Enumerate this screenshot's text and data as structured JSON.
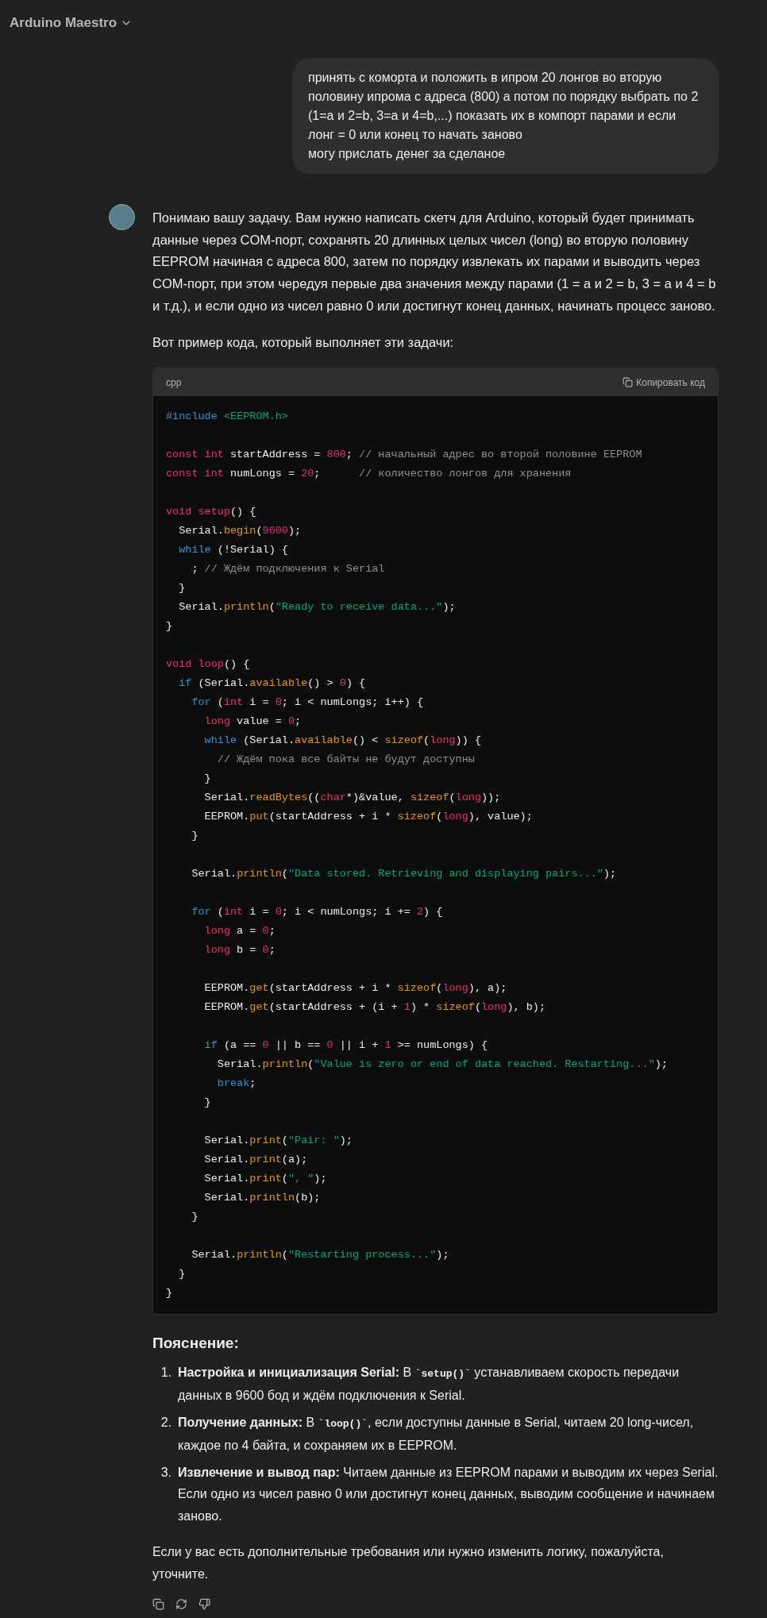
{
  "header": {
    "title": "Arduino Maestro"
  },
  "user_message": {
    "text": "принять с коморта и положить в ипром 20 лонгов во вторую половину ипрома с адреса (800) а потом по порядку выбрать по 2 (1=а и 2=b, 3=a и 4=b,...) показать их в компорт парами и если лонг = 0 или конец то начать заново\nмогу прислать денег за сделаное"
  },
  "assistant": {
    "intro": "Понимаю вашу задачу. Вам нужно написать скетч для Arduino, который будет принимать данные через COM-порт, сохранять 20 длинных целых чисел (long) во вторую половину EEPROM начиная с адреса 800, затем по порядку извлекать их парами и выводить через COM-порт, при этом чередуя первые два значения между парами (1 = a и 2 = b, 3 = a и 4 = b и т.д.), и если одно из чисел равно 0 или достигнут конец данных, начинать процесс заново.",
    "lead": "Вот пример кода, который выполняет эти задачи:",
    "code": {
      "language": "cpp",
      "copy_label": "Копировать код",
      "blocks": [
        [
          [
            {
              "text": "#",
              "kind": "comment"
            },
            {
              "text": "include",
              "kind": "control"
            },
            {
              "text": " <EEPROM.h>",
              "kind": "string"
            }
          ]
        ],
        [
          [
            {
              "text": "const int",
              "kind": "keyword"
            },
            {
              "text": " startAddress = ",
              "kind": "plain"
            },
            {
              "text": "800",
              "kind": "number"
            },
            {
              "text": "; ",
              "kind": "plain"
            },
            {
              "text": "// начальный адрес во второй половине EEPROM",
              "kind": "comment"
            }
          ],
          [
            {
              "text": "const int",
              "kind": "keyword"
            },
            {
              "text": " numLongs = ",
              "kind": "plain"
            },
            {
              "text": "20",
              "kind": "number"
            },
            {
              "text": ";      ",
              "kind": "plain"
            },
            {
              "text": "// количество лонгов для хранения",
              "kind": "comment"
            }
          ]
        ],
        [
          [
            {
              "text": "void setup",
              "kind": "keyword"
            },
            {
              "text": "() {",
              "kind": "plain"
            }
          ],
          [
            {
              "text": "  Serial.",
              "kind": "plain"
            },
            {
              "text": "begin",
              "kind": "function"
            },
            {
              "text": "(",
              "kind": "plain"
            },
            {
              "text": "9600",
              "kind": "number"
            },
            {
              "text": ");",
              "kind": "plain"
            }
          ],
          [
            {
              "text": "  while",
              "kind": "control"
            },
            {
              "text": " (!Serial) {",
              "kind": "plain"
            }
          ],
          [
            {
              "text": "    ; ",
              "kind": "plain"
            },
            {
              "text": "// Ждём подключения к Serial",
              "kind": "comment"
            }
          ],
          [
            {
              "text": "  }",
              "kind": "plain"
            }
          ],
          [
            {
              "text": "  Serial.",
              "kind": "plain"
            },
            {
              "text": "println",
              "kind": "function"
            },
            {
              "text": "(",
              "kind": "plain"
            },
            {
              "text": "\"Ready to receive data...\"",
              "kind": "string"
            },
            {
              "text": ");",
              "kind": "plain"
            }
          ],
          [
            {
              "text": "}",
              "kind": "plain"
            }
          ]
        ],
        [
          [
            {
              "text": "void loop",
              "kind": "keyword"
            },
            {
              "text": "() {",
              "kind": "plain"
            }
          ],
          [
            {
              "text": "  if",
              "kind": "control"
            },
            {
              "text": " (Serial.",
              "kind": "plain"
            },
            {
              "text": "available",
              "kind": "function"
            },
            {
              "text": "() > ",
              "kind": "plain"
            },
            {
              "text": "0",
              "kind": "number"
            },
            {
              "text": ") {",
              "kind": "plain"
            }
          ],
          [
            {
              "text": "    for",
              "kind": "control"
            },
            {
              "text": " (",
              "kind": "plain"
            },
            {
              "text": "int",
              "kind": "keyword"
            },
            {
              "text": " i = ",
              "kind": "plain"
            },
            {
              "text": "0",
              "kind": "number"
            },
            {
              "text": "; i < numLongs; i++) {",
              "kind": "plain"
            }
          ],
          [
            {
              "text": "      long",
              "kind": "keyword"
            },
            {
              "text": " value = ",
              "kind": "plain"
            },
            {
              "text": "0",
              "kind": "number"
            },
            {
              "text": ";",
              "kind": "plain"
            }
          ],
          [
            {
              "text": "      while",
              "kind": "control"
            },
            {
              "text": " (Serial.",
              "kind": "plain"
            },
            {
              "text": "available",
              "kind": "function"
            },
            {
              "text": "() < ",
              "kind": "plain"
            },
            {
              "text": "sizeof",
              "kind": "function"
            },
            {
              "text": "(",
              "kind": "plain"
            },
            {
              "text": "long",
              "kind": "keyword"
            },
            {
              "text": ")) {",
              "kind": "plain"
            }
          ],
          [
            {
              "text": "        // Ждём пока все байты не будут доступны",
              "kind": "comment"
            }
          ],
          [
            {
              "text": "      }",
              "kind": "plain"
            }
          ],
          [
            {
              "text": "      Serial.",
              "kind": "plain"
            },
            {
              "text": "readBytes",
              "kind": "function"
            },
            {
              "text": "((",
              "kind": "plain"
            },
            {
              "text": "char",
              "kind": "keyword"
            },
            {
              "text": "*)&value, ",
              "kind": "plain"
            },
            {
              "text": "sizeof",
              "kind": "function"
            },
            {
              "text": "(",
              "kind": "plain"
            },
            {
              "text": "long",
              "kind": "keyword"
            },
            {
              "text": "));",
              "kind": "plain"
            }
          ],
          [
            {
              "text": "      EEPROM.",
              "kind": "plain"
            },
            {
              "text": "put",
              "kind": "function"
            },
            {
              "text": "(startAddress + i * ",
              "kind": "plain"
            },
            {
              "text": "sizeof",
              "kind": "function"
            },
            {
              "text": "(",
              "kind": "plain"
            },
            {
              "text": "long",
              "kind": "keyword"
            },
            {
              "text": "), value);",
              "kind": "plain"
            }
          ],
          [
            {
              "text": "    }",
              "kind": "plain"
            }
          ]
        ],
        [
          [
            {
              "text": "    Serial.",
              "kind": "plain"
            },
            {
              "text": "println",
              "kind": "function"
            },
            {
              "text": "(",
              "kind": "plain"
            },
            {
              "text": "\"Data stored. Retrieving and displaying pairs...\"",
              "kind": "string"
            },
            {
              "text": ");",
              "kind": "plain"
            }
          ]
        ],
        [
          [
            {
              "text": "    for",
              "kind": "control"
            },
            {
              "text": " (",
              "kind": "plain"
            },
            {
              "text": "int",
              "kind": "keyword"
            },
            {
              "text": " i = ",
              "kind": "plain"
            },
            {
              "text": "0",
              "kind": "number"
            },
            {
              "text": "; i < numLongs; i += ",
              "kind": "plain"
            },
            {
              "text": "2",
              "kind": "number"
            },
            {
              "text": ") {",
              "kind": "plain"
            }
          ],
          [
            {
              "text": "      long",
              "kind": "keyword"
            },
            {
              "text": " a = ",
              "kind": "plain"
            },
            {
              "text": "0",
              "kind": "number"
            },
            {
              "text": ";",
              "kind": "plain"
            }
          ],
          [
            {
              "text": "      long",
              "kind": "keyword"
            },
            {
              "text": " b = ",
              "kind": "plain"
            },
            {
              "text": "0",
              "kind": "number"
            },
            {
              "text": ";",
              "kind": "plain"
            }
          ]
        ],
        [
          [
            {
              "text": "      EEPROM.",
              "kind": "plain"
            },
            {
              "text": "get",
              "kind": "function"
            },
            {
              "text": "(startAddress + i * ",
              "kind": "plain"
            },
            {
              "text": "sizeof",
              "kind": "function"
            },
            {
              "text": "(",
              "kind": "plain"
            },
            {
              "text": "long",
              "kind": "keyword"
            },
            {
              "text": "), a);",
              "kind": "plain"
            }
          ],
          [
            {
              "text": "      EEPROM.",
              "kind": "plain"
            },
            {
              "text": "get",
              "kind": "function"
            },
            {
              "text": "(startAddress + (i + ",
              "kind": "plain"
            },
            {
              "text": "1",
              "kind": "number"
            },
            {
              "text": ") * ",
              "kind": "plain"
            },
            {
              "text": "sizeof",
              "kind": "function"
            },
            {
              "text": "(",
              "kind": "plain"
            },
            {
              "text": "long",
              "kind": "keyword"
            },
            {
              "text": "), b);",
              "kind": "plain"
            }
          ]
        ],
        [
          [
            {
              "text": "      if",
              "kind": "control"
            },
            {
              "text": " (a == ",
              "kind": "plain"
            },
            {
              "text": "0",
              "kind": "number"
            },
            {
              "text": " || b == ",
              "kind": "plain"
            },
            {
              "text": "0",
              "kind": "number"
            },
            {
              "text": " || i + ",
              "kind": "plain"
            },
            {
              "text": "1",
              "kind": "number"
            },
            {
              "text": " >= numLongs) {",
              "kind": "plain"
            }
          ],
          [
            {
              "text": "        Serial.",
              "kind": "plain"
            },
            {
              "text": "println",
              "kind": "function"
            },
            {
              "text": "(",
              "kind": "plain"
            },
            {
              "text": "\"Value is zero or end of data reached. Restarting...\"",
              "kind": "string"
            },
            {
              "text": ");",
              "kind": "plain"
            }
          ],
          [
            {
              "text": "        break",
              "kind": "control"
            },
            {
              "text": ";",
              "kind": "plain"
            }
          ],
          [
            {
              "text": "      }",
              "kind": "plain"
            }
          ]
        ],
        [
          [
            {
              "text": "      Serial.",
              "kind": "plain"
            },
            {
              "text": "print",
              "kind": "function"
            },
            {
              "text": "(",
              "kind": "plain"
            },
            {
              "text": "\"Pair: \"",
              "kind": "string"
            },
            {
              "text": ");",
              "kind": "plain"
            }
          ],
          [
            {
              "text": "      Serial.",
              "kind": "plain"
            },
            {
              "text": "print",
              "kind": "function"
            },
            {
              "text": "(a);",
              "kind": "plain"
            }
          ],
          [
            {
              "text": "      Serial.",
              "kind": "plain"
            },
            {
              "text": "print",
              "kind": "function"
            },
            {
              "text": "(",
              "kind": "plain"
            },
            {
              "text": "\", \"",
              "kind": "string"
            },
            {
              "text": ");",
              "kind": "plain"
            }
          ],
          [
            {
              "text": "      Serial.",
              "kind": "plain"
            },
            {
              "text": "println",
              "kind": "function"
            },
            {
              "text": "(b);",
              "kind": "plain"
            }
          ],
          [
            {
              "text": "    }",
              "kind": "plain"
            }
          ]
        ],
        [
          [
            {
              "text": "    Serial.",
              "kind": "plain"
            },
            {
              "text": "println",
              "kind": "function"
            },
            {
              "text": "(",
              "kind": "plain"
            },
            {
              "text": "\"Restarting process...\"",
              "kind": "string"
            },
            {
              "text": ");",
              "kind": "plain"
            }
          ],
          [
            {
              "text": "  }",
              "kind": "plain"
            }
          ],
          [
            {
              "text": "}",
              "kind": "plain"
            }
          ]
        ]
      ]
    },
    "explanation_heading": "Пояснение:",
    "explanation": [
      {
        "number": "1.",
        "title": "Настройка и инициализация Serial:",
        "parts": [
          {
            "kind": "text",
            "text": " В "
          },
          {
            "kind": "code",
            "text": "`setup()`"
          },
          {
            "kind": "text",
            "text": " устанавливаем скорость передачи данных в 9600 бод и ждём подключения к Serial."
          }
        ]
      },
      {
        "number": "2.",
        "title": "Получение данных:",
        "parts": [
          {
            "kind": "text",
            "text": " В "
          },
          {
            "kind": "code",
            "text": "`loop()`"
          },
          {
            "kind": "text",
            "text": ", если доступны данные в Serial, читаем 20 long-чисел, каждое по 4 байта, и сохраняем их в EEPROM."
          }
        ]
      },
      {
        "number": "3.",
        "title": "Извлечение и вывод пар:",
        "parts": [
          {
            "kind": "text",
            "text": " Читаем данные из EEPROM парами и выводим их через Serial. Если одно из чисел равно 0 или достигнут конец данных, выводим сообщение и начинаем заново."
          }
        ]
      }
    ],
    "closing": "Если у вас есть дополнительные требования или нужно изменить логику, пожалуйста, уточните."
  }
}
